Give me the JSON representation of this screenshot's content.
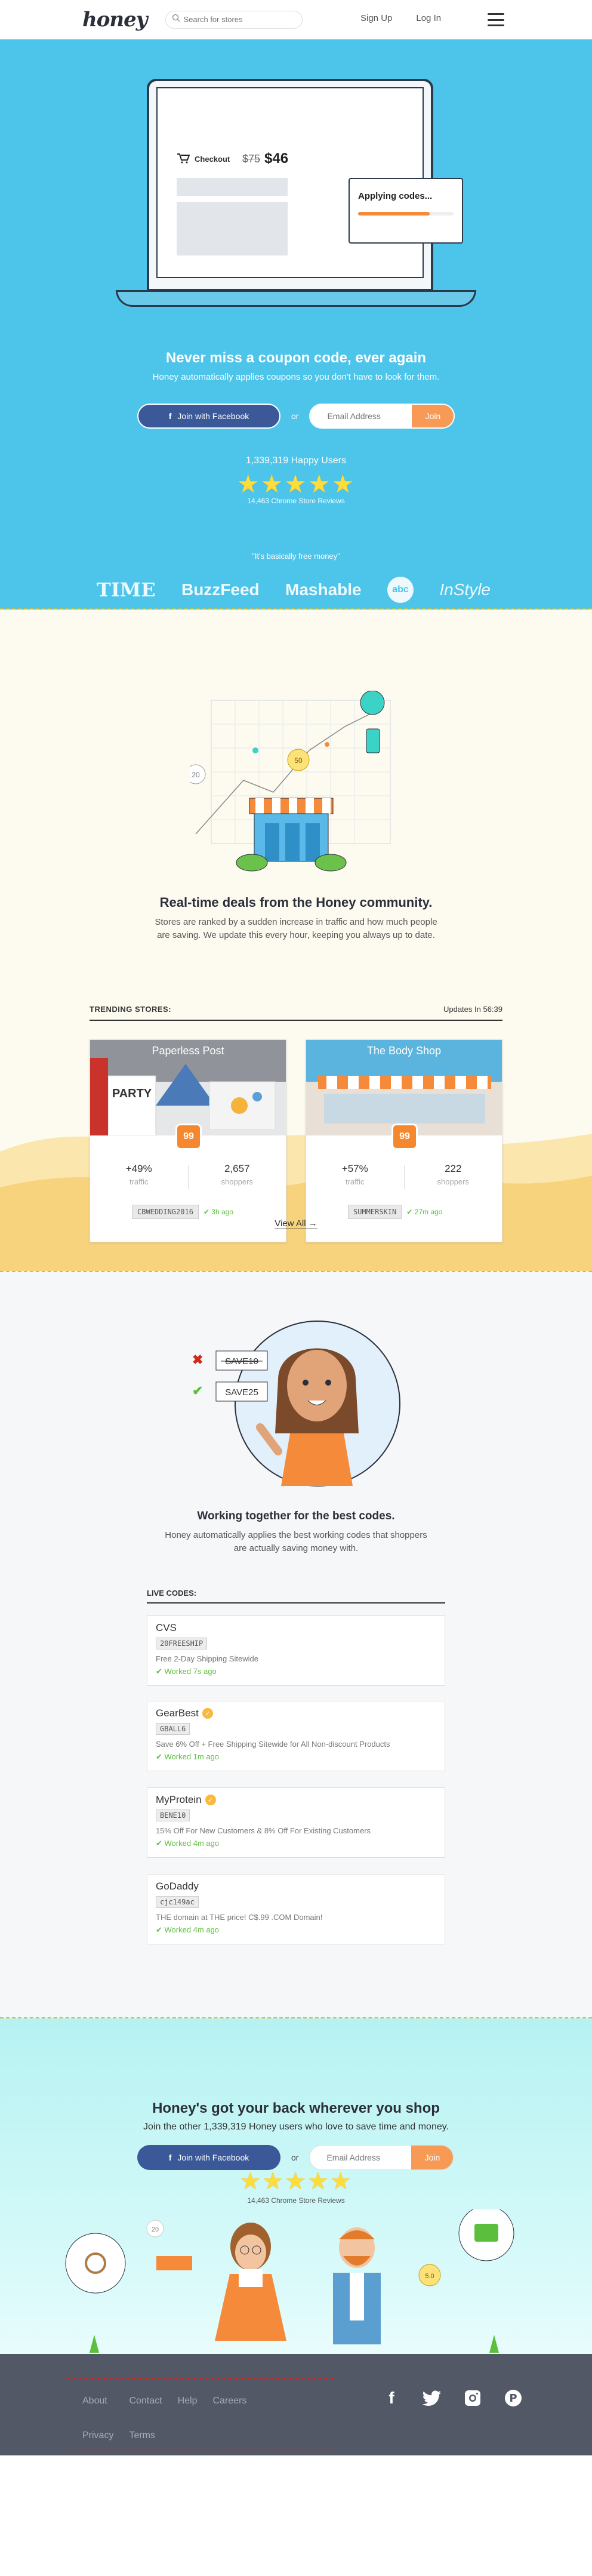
{
  "header": {
    "logo": "honey",
    "search_placeholder": "Search for stores",
    "signup": "Sign Up",
    "login": "Log In"
  },
  "hero": {
    "checkout_label": "Checkout",
    "old_price": "$75",
    "new_price": "$46",
    "applying": "Applying codes...",
    "applying_progress": 0.75,
    "title": "Never miss a coupon code, ever again",
    "subtitle": "Honey automatically applies coupons so you don't have to look for them.",
    "facebook_btn": "Join with Facebook",
    "or": "or",
    "email_placeholder": "Email Address",
    "join_btn": "Join",
    "happy_users": "1,339,319 Happy Users",
    "stars": "★★★★★",
    "reviews": "14,463 Chrome Store Reviews",
    "quote": "\"It's basically free money\"",
    "press": [
      "TIME",
      "BuzzFeed",
      "Mashable",
      "abc",
      "InStyle"
    ]
  },
  "trending": {
    "title": "Real-time deals from the Honey community.",
    "subtitle": "Stores are ranked by a sudden increase in traffic and how much people are saving. We update this every hour, keeping you always up to date.",
    "header_label": "TRENDING STORES:",
    "updates": "Updates In 56:39",
    "coin_1": "20",
    "coin_2": "50",
    "cards": [
      {
        "name": "Paperless Post",
        "score": "99",
        "traffic": "+49%",
        "traffic_label": "traffic",
        "shoppers": "2,657",
        "shoppers_label": "shoppers",
        "code": "CBWEDDING2016",
        "worked": "✔ 3h ago",
        "sign": "PARTY"
      },
      {
        "name": "The Body Shop",
        "score": "99",
        "traffic": "+57%",
        "traffic_label": "traffic",
        "shoppers": "222",
        "shoppers_label": "shoppers",
        "code": "SUMMERSKIN",
        "worked": "✔ 27m ago"
      }
    ],
    "view_all": "View All →"
  },
  "live": {
    "bad_code": "SAVE10",
    "good_code": "SAVE25",
    "title": "Working together for the best codes.",
    "subtitle": "Honey automatically applies the best working codes that shoppers are actually saving money with.",
    "header_label": "LIVE CODES:",
    "items": [
      {
        "store": "CVS",
        "code": "20FREESHIP",
        "desc": "Free 2-Day Shipping Sitewide",
        "worked": "✔ Worked 7s ago",
        "verified": false
      },
      {
        "store": "GearBest",
        "code": "GBALL6",
        "desc": "Save 6% Off + Free Shipping Sitewide for All Non-discount Products",
        "worked": "✔ Worked 1m ago",
        "verified": true
      },
      {
        "store": "MyProtein",
        "code": "BENE10",
        "desc": "15% Off For New Customers & 8% Off For Existing Customers",
        "worked": "✔ Worked 4m ago",
        "verified": true
      },
      {
        "store": "GoDaddy",
        "code": "cjc149ac",
        "desc": "THE domain at THE price! C$.99 .COM Domain!",
        "worked": "✔ Worked 4m ago",
        "verified": false
      }
    ]
  },
  "bottom": {
    "title": "Honey's got your back wherever you shop",
    "subtitle": "Join the other 1,339,319 Honey users who love to save time and money.",
    "facebook_btn": "Join with Facebook",
    "or": "or",
    "email_placeholder": "Email Address",
    "join_btn": "Join",
    "stars": "★★★★★",
    "reviews": "14,463 Chrome Store Reviews",
    "coin_1": "20",
    "coin_2": "5.0"
  },
  "footer": {
    "links": [
      "About",
      "Contact",
      "Help",
      "Careers",
      "Privacy",
      "Terms"
    ],
    "social": [
      "facebook-icon",
      "twitter-icon",
      "instagram-icon",
      "pinterest-icon"
    ]
  },
  "colors": {
    "hero_bg": "#4dc4ea",
    "accent_orange": "#f58a3a",
    "facebook": "#3b5998",
    "footer_bg": "#525866",
    "worked_green": "#5bbf3d"
  }
}
